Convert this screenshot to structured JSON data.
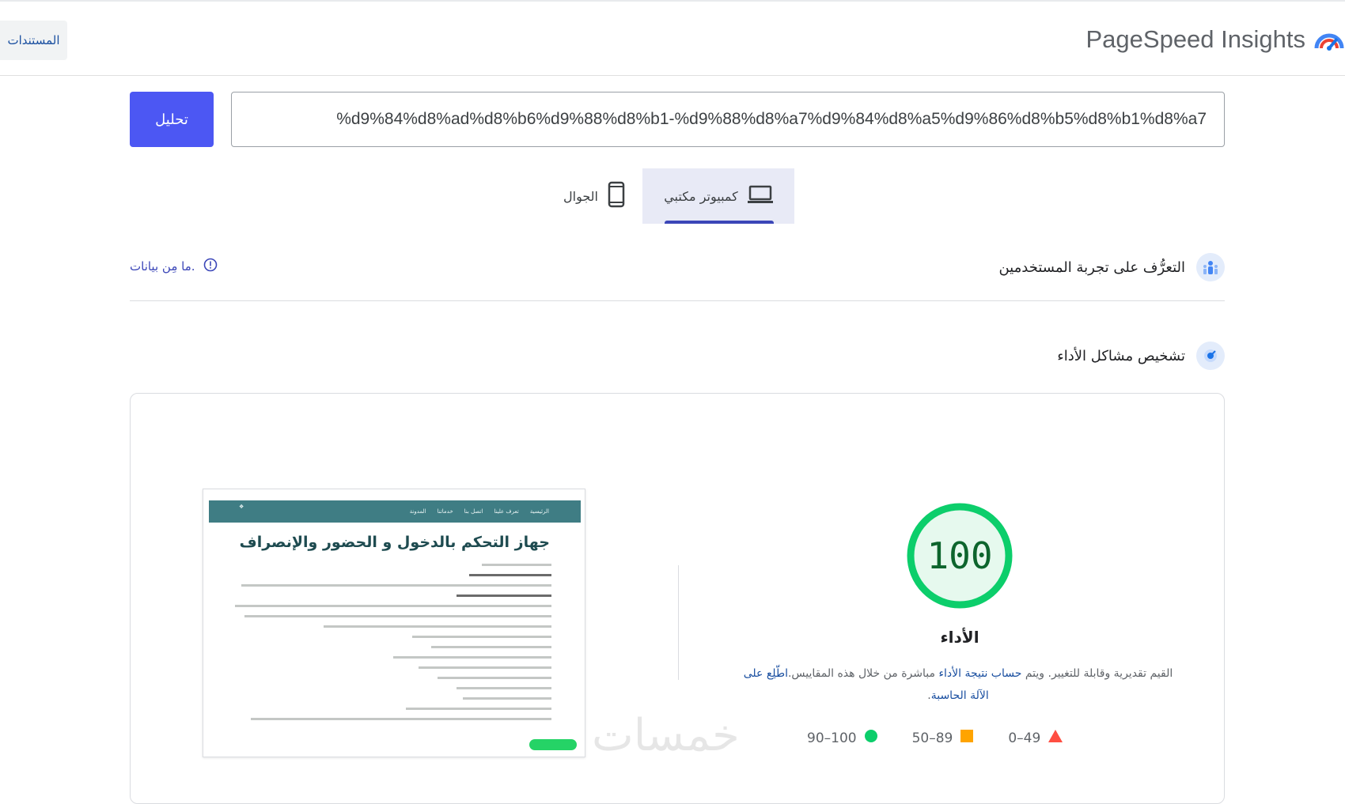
{
  "header": {
    "title": "PageSpeed Insights",
    "docs_label": "المستندات"
  },
  "search": {
    "url_value": "%d9%84%d8%ad%d8%b6%d9%88%d8%b1-%d9%88%d8%a7%d9%84%d8%a5%d9%86%d8%b5%d8%b1%d8%a7",
    "analyze_label": "تحليل"
  },
  "tabs": {
    "mobile_label": "الجوال",
    "desktop_label": "كمبيوتر مكتبي",
    "active": "desktop"
  },
  "user_experience": {
    "title": "التعرُّف على تجربة المستخدمين",
    "no_data_label": "ما مِن بيانات."
  },
  "diagnostics": {
    "title": "تشخيص مشاكل الأداء"
  },
  "score": {
    "value": "100",
    "fraction": 1.0,
    "label": "الأداء",
    "color": "#0cce6b"
  },
  "description": {
    "text_before": "القيم تقديرية وقابلة للتغيير. ويتم ",
    "link1": "حساب نتيجة الأداء",
    "text_middle": " مباشرة من خلال هذه المقاييس.",
    "link2": "اطّلِع على الآلة الحاسبة",
    "text_after": "."
  },
  "legend": [
    {
      "range": "0–49",
      "color": "#ff4e42",
      "shape": "triangle"
    },
    {
      "range": "50–89",
      "color": "#ffa400",
      "shape": "square"
    },
    {
      "range": "90–100",
      "color": "#0cce6b",
      "shape": "circle"
    }
  ],
  "thumbnail": {
    "heading": "جهاز التحكم بالدخول و الحضور والإنصراف",
    "nav_items": [
      "الرئيسية",
      "تعرف علينا",
      "اتصل بنا",
      "خدماتنا",
      "المدونة"
    ]
  },
  "watermark": "خمسات"
}
